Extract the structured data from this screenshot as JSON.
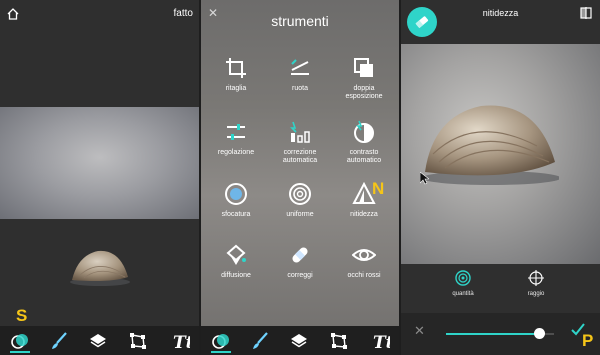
{
  "panel1": {
    "done_label": "fatto",
    "annotation": "S"
  },
  "panel2": {
    "title": "strumenti",
    "annotation": "N",
    "tools": [
      {
        "label": "ritaglia",
        "icon": "crop-icon"
      },
      {
        "label": "ruota",
        "icon": "rotate-icon"
      },
      {
        "label": "doppia\nesposizione",
        "icon": "double-exposure-icon"
      },
      {
        "label": "regolazione",
        "icon": "adjust-icon"
      },
      {
        "label": "correzione\nautomatica",
        "icon": "auto-fix-icon"
      },
      {
        "label": "contrasto\nautomatico",
        "icon": "auto-contrast-icon"
      },
      {
        "label": "sfocatura",
        "icon": "blur-icon"
      },
      {
        "label": "uniforme",
        "icon": "smooth-icon"
      },
      {
        "label": "nitidezza",
        "icon": "sharpen-icon"
      },
      {
        "label": "diffusione",
        "icon": "diffusion-icon"
      },
      {
        "label": "correggi",
        "icon": "heal-icon"
      },
      {
        "label": "occhi rossi",
        "icon": "red-eye-icon"
      }
    ]
  },
  "panel3": {
    "title": "nitidezza",
    "annotation": "P",
    "options": [
      {
        "label": "quantità",
        "icon": "amount-icon",
        "active": true
      },
      {
        "label": "raggio",
        "icon": "radius-icon",
        "active": false
      }
    ],
    "slider_value": 0.86
  },
  "toolbar": {
    "items": [
      "effects-icon",
      "brush-icon",
      "layers-icon",
      "transform-icon",
      "text-icon"
    ]
  },
  "colors": {
    "accent": "#2fd4c9",
    "annotation": "#f5c518",
    "toolbar_bg": "#1f1f1f"
  }
}
